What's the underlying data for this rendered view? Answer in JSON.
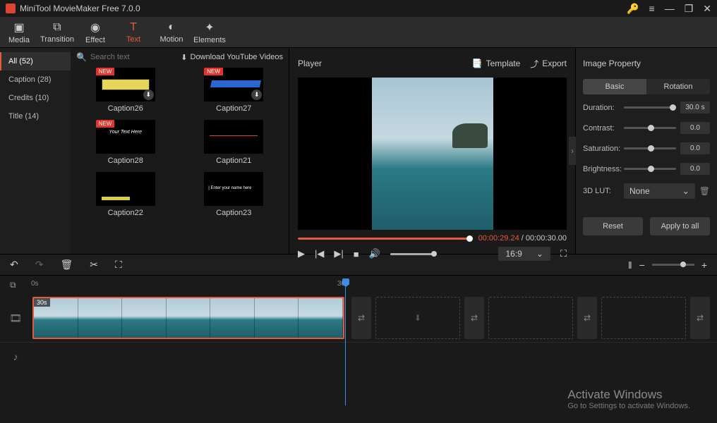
{
  "app": {
    "title": "MiniTool MovieMaker Free 7.0.0"
  },
  "toolbar": {
    "tabs": [
      {
        "id": "media",
        "label": "Media"
      },
      {
        "id": "transition",
        "label": "Transition"
      },
      {
        "id": "effect",
        "label": "Effect"
      },
      {
        "id": "text",
        "label": "Text"
      },
      {
        "id": "motion",
        "label": "Motion"
      },
      {
        "id": "elements",
        "label": "Elements"
      }
    ],
    "player_label": "Player",
    "template_label": "Template",
    "export_label": "Export",
    "props_label": "Image Property"
  },
  "browser": {
    "categories": [
      {
        "label": "All (52)",
        "active": true
      },
      {
        "label": "Caption (28)",
        "active": false
      },
      {
        "label": "Credits (10)",
        "active": false
      },
      {
        "label": "Title (14)",
        "active": false
      }
    ],
    "search_placeholder": "Search text",
    "download_link": "Download YouTube Videos",
    "thumbs": [
      {
        "label": "Caption26",
        "new": true,
        "cls": "c26",
        "dl": true
      },
      {
        "label": "Caption27",
        "new": true,
        "cls": "c27",
        "dl": true
      },
      {
        "label": "Caption28",
        "new": true,
        "cls": "c28"
      },
      {
        "label": "Caption21",
        "cls": "c21"
      },
      {
        "label": "Caption22",
        "cls": "c22"
      },
      {
        "label": "Caption23",
        "cls": "c23"
      }
    ]
  },
  "preview": {
    "time_current": "00:00:29.24",
    "time_sep": " / ",
    "time_total": "00:00:30.00",
    "aspect": "16:9"
  },
  "props": {
    "tab_basic": "Basic",
    "tab_rotation": "Rotation",
    "duration_label": "Duration:",
    "duration_value": "30.0 s",
    "contrast_label": "Contrast:",
    "contrast_value": "0.0",
    "saturation_label": "Saturation:",
    "saturation_value": "0.0",
    "brightness_label": "Brightness:",
    "brightness_value": "0.0",
    "lut_label": "3D LUT:",
    "lut_value": "None",
    "reset": "Reset",
    "apply": "Apply to all"
  },
  "ruler": {
    "t0": "0s",
    "t30": "30s"
  },
  "timeline": {
    "clip_duration": "30s"
  },
  "watermark": {
    "l1": "Activate Windows",
    "l2": "Go to Settings to activate Windows."
  }
}
